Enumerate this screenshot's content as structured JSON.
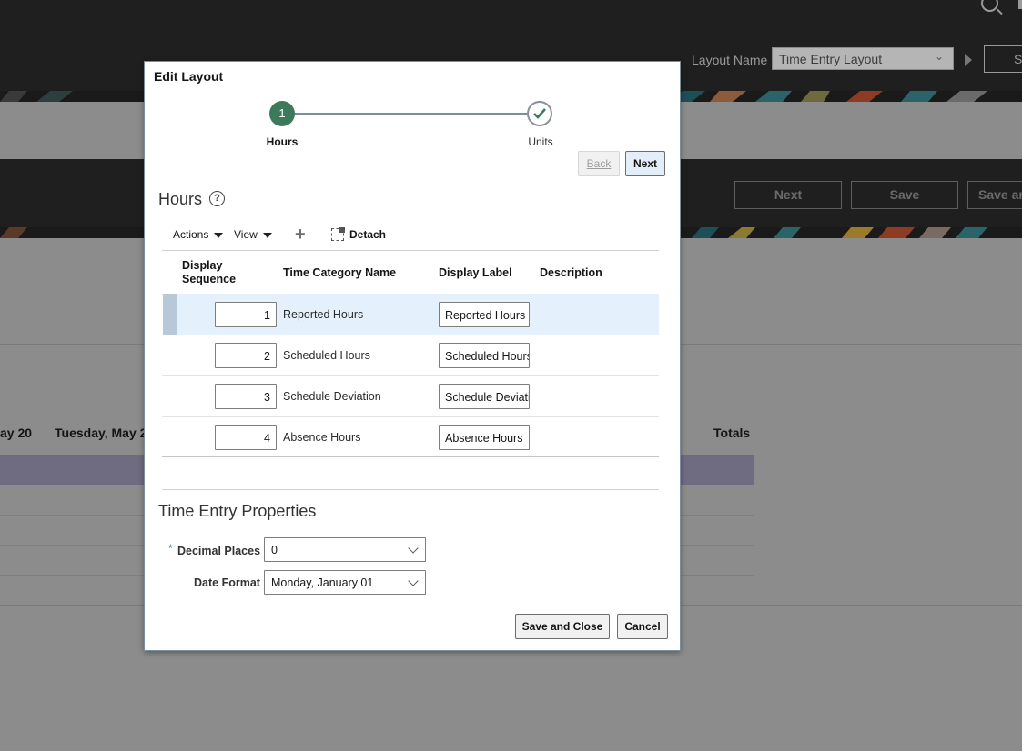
{
  "background": {
    "layout_name_label": "Layout Name",
    "layout_name_value": "Time Entry Layout",
    "top_button_label": "Sa",
    "header_buttons": [
      "Next",
      "Save",
      "Save an"
    ],
    "day_headers": [
      "ay 20",
      "Tuesday, May 2"
    ],
    "totals_label": "Totals"
  },
  "modal": {
    "title": "Edit Layout",
    "train": [
      {
        "number": "1",
        "label": "Hours",
        "state": "current"
      },
      {
        "number": "",
        "label": "Units",
        "state": "complete"
      }
    ],
    "back_label": "Back",
    "next_label": "Next",
    "hours_heading": "Hours",
    "help_icon_glyph": "?",
    "toolbar": {
      "actions_label": "Actions",
      "view_label": "View",
      "detach_label": "Detach"
    },
    "table": {
      "headers": {
        "display_sequence_line1": "Display",
        "display_sequence_line2": "Sequence",
        "time_category_name": "Time Category Name",
        "display_label": "Display Label",
        "description": "Description"
      },
      "rows": [
        {
          "sequence": "1",
          "category": "Reported Hours",
          "label": "Reported Hours",
          "description": ""
        },
        {
          "sequence": "2",
          "category": "Scheduled Hours",
          "label": "Scheduled Hours",
          "description": ""
        },
        {
          "sequence": "3",
          "category": "Schedule Deviation",
          "label": "Schedule Deviation",
          "description": ""
        },
        {
          "sequence": "4",
          "category": "Absence Hours",
          "label": "Absence Hours",
          "description": ""
        }
      ]
    },
    "properties_heading": "Time Entry Properties",
    "decimal_places_label": "Decimal Places",
    "decimal_places_value": "0",
    "date_format_label": "Date Format",
    "date_format_value": "Monday, January 01",
    "save_close_label": "Save and Close",
    "cancel_label": "Cancel"
  },
  "colors": {
    "train_current": "#3d7a5c",
    "selected_row": "#e4f0fb",
    "overlay_gray": "#8c8c8c"
  }
}
